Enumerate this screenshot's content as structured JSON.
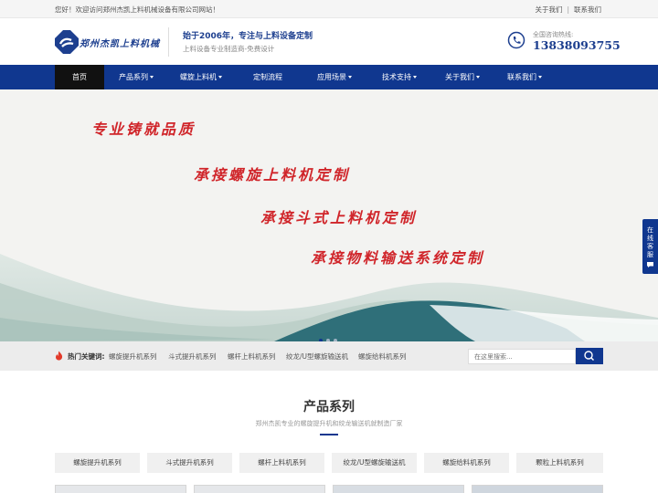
{
  "topbar": {
    "welcome": "您好！欢迎访问郑州杰凯上料机械设备有限公司网站！",
    "links": [
      "关于我们",
      "联系我们"
    ]
  },
  "header": {
    "logo_text": "郑州杰凯上料机械",
    "slogan_main": "始于2006年，专注与上料设备定制",
    "slogan_sub": "上料设备专业制造商-免费设计",
    "hotline_label": "全国咨询热线:",
    "hotline_number": "13838093755"
  },
  "nav": {
    "items": [
      {
        "label": "首页"
      },
      {
        "label": "产品系列"
      },
      {
        "label": "螺旋上料机"
      },
      {
        "label": "定制流程"
      },
      {
        "label": "应用场景"
      },
      {
        "label": "技术支持"
      },
      {
        "label": "关于我们"
      },
      {
        "label": "联系我们"
      }
    ],
    "active_index": 0
  },
  "banner": {
    "lines": [
      "专业铸就品质",
      "承接螺旋上料机定制",
      "承接斗式上料机定制",
      "承接物料输送系统定制"
    ],
    "slide_count": 3,
    "active_slide": 0
  },
  "side_float": {
    "text": [
      "在",
      "线",
      "客",
      "服"
    ],
    "icon": "chat-icon"
  },
  "keywords": {
    "label": "热门关键词:",
    "items": [
      "螺旋提升机系列",
      "斗式提升机系列",
      "螺杆上料机系列",
      "绞龙/U型螺旋输送机",
      "螺旋给料机系列"
    ],
    "search_placeholder": "在这里搜索...",
    "search_icon": "search-icon"
  },
  "products": {
    "title": "产品系列",
    "subtitle": "郑州杰凯专业的螺旋提升机和绞龙输送机就制造厂家",
    "tabs": [
      "螺旋提升机系列",
      "斗式提升机系列",
      "螺杆上料机系列",
      "绞龙/U型螺旋输送机",
      "螺旋给料机系列",
      "颗粒上料机系列"
    ]
  },
  "colors": {
    "brand_blue": "#10378f",
    "nav_active": "#111111",
    "banner_red": "#d0252a"
  }
}
